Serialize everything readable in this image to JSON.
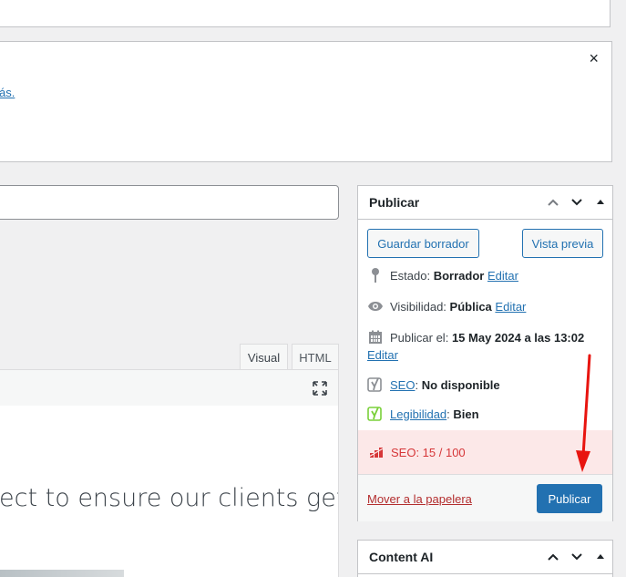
{
  "notice": {
    "link_fragment": "ás.",
    "dismiss_glyph": "×"
  },
  "editor": {
    "tabs": {
      "visual": "Visual",
      "html": "HTML"
    },
    "content_text": "ect to ensure our clients get"
  },
  "publish": {
    "title": "Publicar",
    "save_draft": "Guardar borrador",
    "preview": "Vista previa",
    "status_label": "Estado:",
    "status_value": "Borrador",
    "visibility_label": "Visibilidad:",
    "visibility_value": "Pública",
    "publish_on_label": "Publicar el:",
    "publish_on_value": "15 May 2024 a las 13:02",
    "edit_label": "Editar",
    "seo_link": "SEO",
    "seo_value": "No disponible",
    "legibility_link": "Legibilidad",
    "legibility_value": "Bien",
    "seo_score": "SEO: 15 / 100",
    "trash": "Mover a la papelera",
    "publish_button": "Publicar"
  },
  "content_ai": {
    "title": "Content AI"
  },
  "icons": {
    "status": "pin-icon",
    "visibility": "eye-icon",
    "date": "calendar-icon",
    "seo": "yoast-icon",
    "legibility": "yoast-icon",
    "score": "rank-math-icon"
  },
  "colors": {
    "primary": "#2271b1",
    "danger": "#d63638",
    "yoast_gray": "#8c8f94",
    "yoast_green": "#7ad03a",
    "seo_bg": "#fce8e8",
    "annotation": "#e8140f"
  }
}
